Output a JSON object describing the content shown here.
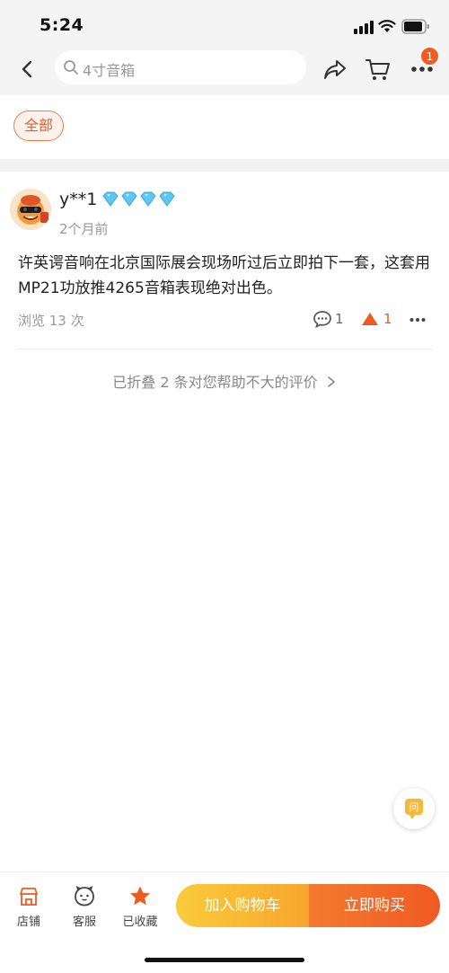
{
  "status_bar": {
    "time": "5:24"
  },
  "header": {
    "search_placeholder": "4寸音箱",
    "notification_count": "1"
  },
  "filters": {
    "active_chip": "全部"
  },
  "review": {
    "username": "y**1",
    "vip_level_diamonds": 4,
    "date": "2个月前",
    "content": "许英谔音响在北京国际展会现场听过后立即拍下一套，这套用MP21功放推4265音箱表现绝对出色。",
    "views": "浏览 13 次",
    "comment_count": "1",
    "like_count": "1"
  },
  "folded_notice": "已折叠 2 条对您帮助不大的评价",
  "float_button": {
    "label": "问"
  },
  "bottom_bar": {
    "tabs": [
      {
        "label": "店铺",
        "icon": "shop-icon"
      },
      {
        "label": "客服",
        "icon": "customer-service-icon"
      },
      {
        "label": "已收藏",
        "icon": "star-icon"
      }
    ],
    "add_to_cart": "加入购物车",
    "buy_now": "立即购买"
  },
  "colors": {
    "accent": "#ee5a24",
    "cart_button": "#f9b932",
    "buy_button": "#f06828",
    "diamond": "#5cc8f2"
  }
}
